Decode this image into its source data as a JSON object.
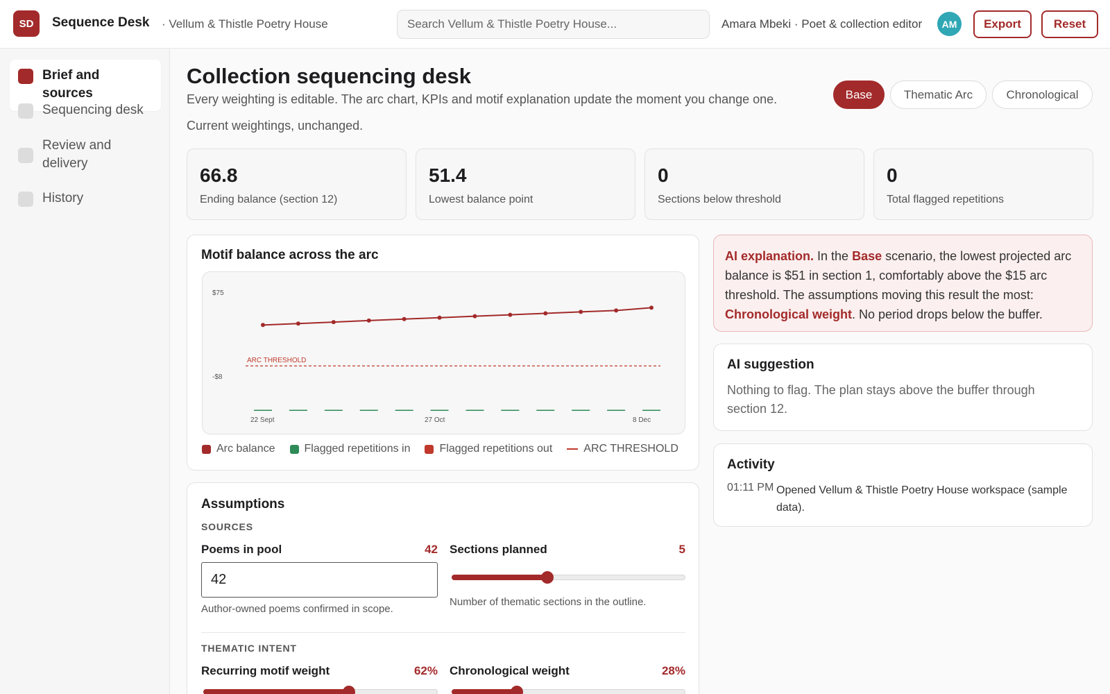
{
  "header": {
    "logo_initials": "SD",
    "app_title": "Sequence Desk",
    "workspace": "· Vellum & Thistle Poetry House",
    "search_placeholder": "Search Vellum & Thistle Poetry House...",
    "user": "Amara Mbeki · Poet & collection editor",
    "avatar_initials": "AM",
    "export_label": "Export",
    "reset_label": "Reset"
  },
  "sidebar": {
    "items": [
      {
        "label": "Brief and sources",
        "active": true
      },
      {
        "label": "Sequencing desk",
        "active": false
      },
      {
        "label": "Review and delivery",
        "active": false
      },
      {
        "label": "History",
        "active": false
      }
    ]
  },
  "main": {
    "title": "Collection sequencing desk",
    "subtitle": "Every weighting is editable. The arc chart, KPIs and motif explanation update the moment you change one.",
    "status": "Current weightings, unchanged.",
    "scenarios": [
      "Base",
      "Thematic Arc",
      "Chronological"
    ],
    "active_scenario": "Base"
  },
  "kpis": [
    {
      "value": "66.8",
      "label": "Ending balance (section 12)"
    },
    {
      "value": "51.4",
      "label": "Lowest balance point"
    },
    {
      "value": "0",
      "label": "Sections below threshold"
    },
    {
      "value": "0",
      "label": "Total flagged repetitions"
    }
  ],
  "chart_card": {
    "title": "Motif balance across the arc"
  },
  "chart_data": {
    "type": "line",
    "title": "Motif balance across the arc",
    "x_ticks": [
      "22 Sept",
      "27 Oct",
      "8 Dec"
    ],
    "y_ticks": [
      "$75",
      "-$8"
    ],
    "ylim": [
      -25,
      80
    ],
    "threshold": {
      "label": "ARC THRESHOLD",
      "value": 15
    },
    "series": [
      {
        "name": "Arc balance",
        "values": [
          51.4,
          52.7,
          54.0,
          55.4,
          56.7,
          57.9,
          59.2,
          60.5,
          61.8,
          63.1,
          64.3,
          66.8
        ]
      },
      {
        "name": "Flagged repetitions in",
        "values": [
          0,
          0,
          0,
          0,
          0,
          0,
          0,
          0,
          0,
          0,
          0,
          0
        ]
      },
      {
        "name": "Flagged repetitions out",
        "values": [
          0,
          0,
          0,
          0,
          0,
          0,
          0,
          0,
          0,
          0,
          0,
          0
        ]
      }
    ],
    "legend": [
      "Arc balance",
      "Flagged repetitions in",
      "Flagged repetitions out",
      "ARC THRESHOLD"
    ],
    "legend_placement": "bottom",
    "grid": false
  },
  "colors": {
    "accent": "#a32a2a",
    "green": "#2e8b57",
    "threshold": "#c0392b"
  },
  "assumptions": {
    "title": "Assumptions",
    "sources_label": "SOURCES",
    "poems_label": "Poems in pool",
    "poems_value": "42",
    "poems_input": "42",
    "poems_help": "Author-owned poems confirmed in scope.",
    "sections_label": "Sections planned",
    "sections_value": "5",
    "sections_fraction": 0.41,
    "sections_help": "Number of thematic sections in the outline.",
    "intent_label": "THEMATIC INTENT",
    "motif_label": "Recurring motif weight",
    "motif_value": "62%",
    "motif_fraction": 0.62,
    "chrono_label": "Chronological weight",
    "chrono_value": "28%",
    "chrono_fraction": 0.28
  },
  "ai_explanation": {
    "lead": "AI explanation.",
    "t1": " In the ",
    "scenario": "Base",
    "t2": " scenario, the lowest projected arc balance is $51 in section 1, comfortably above the $15 arc threshold. The assumptions moving this result the most: ",
    "driver": "Chronological weight",
    "t3": ". No period drops below the buffer."
  },
  "suggestion": {
    "title": "AI suggestion",
    "text": "Nothing to flag. The plan stays above the buffer through section 12."
  },
  "activity": {
    "title": "Activity",
    "time": "01:11 PM",
    "text": "Opened Vellum & Thistle Poetry House workspace (sample data)."
  }
}
